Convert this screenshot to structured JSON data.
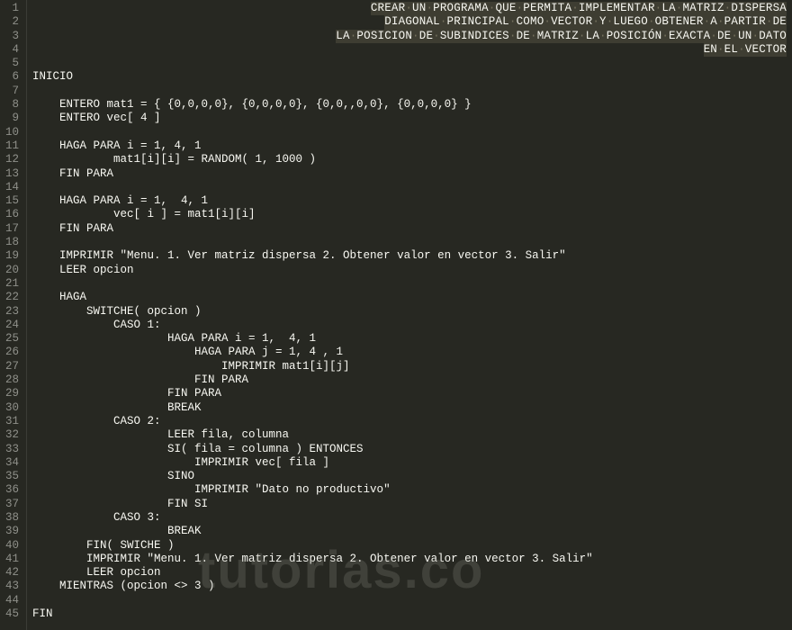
{
  "editor": {
    "start_line": 1,
    "comment_block": [
      "CREAR·UN·PROGRAMA·QUE·PERMITA·IMPLEMENTAR·LA·MATRIZ·DISPERSA",
      "DIAGONAL·PRINCIPAL·COMO·VECTOR·Y·LUEGO·OBTENER·A·PARTIR·DE",
      "LA·POSICION·DE·SUBINDICES·DE·MATRIZ·LA·POSICIÓN·EXACTA·DE·UN·DATO",
      "EN·EL·VECTOR"
    ],
    "lines": [
      "",
      "INICIO",
      "",
      "    ENTERO mat1 = { {0,0,0,0}, {0,0,0,0}, {0,0,,0,0}, {0,0,0,0} }",
      "    ENTERO vec[ 4 ]",
      "",
      "    HAGA PARA i = 1, 4, 1",
      "            mat1[i][i] = RANDOM( 1, 1000 )",
      "    FIN PARA",
      "",
      "    HAGA PARA i = 1,  4, 1",
      "            vec[ i ] = mat1[i][i]",
      "    FIN PARA",
      "",
      "    IMPRIMIR \"Menu. 1. Ver matriz dispersa 2. Obtener valor en vector 3. Salir\"",
      "    LEER opcion",
      "",
      "    HAGA",
      "        SWITCHE( opcion )",
      "            CASO 1:",
      "                    HAGA PARA i = 1,  4, 1",
      "                        HAGA PARA j = 1, 4 , 1",
      "                            IMPRIMIR mat1[i][j]",
      "                        FIN PARA",
      "                    FIN PARA",
      "                    BREAK",
      "            CASO 2:",
      "                    LEER fila, columna",
      "                    SI( fila = columna ) ENTONCES",
      "                        IMPRIMIR vec[ fila ]",
      "                    SINO",
      "                        IMPRIMIR \"Dato no productivo\"",
      "                    FIN SI",
      "            CASO 3:",
      "                    BREAK",
      "        FIN( SWICHE )",
      "        IMPRIMIR \"Menu. 1. Ver matriz dispersa 2. Obtener valor en vector 3. Salir\"",
      "        LEER opcion",
      "    MIENTRAS (opcion <> 3 )",
      "",
      "FIN"
    ]
  },
  "watermark": "tutorias.co"
}
